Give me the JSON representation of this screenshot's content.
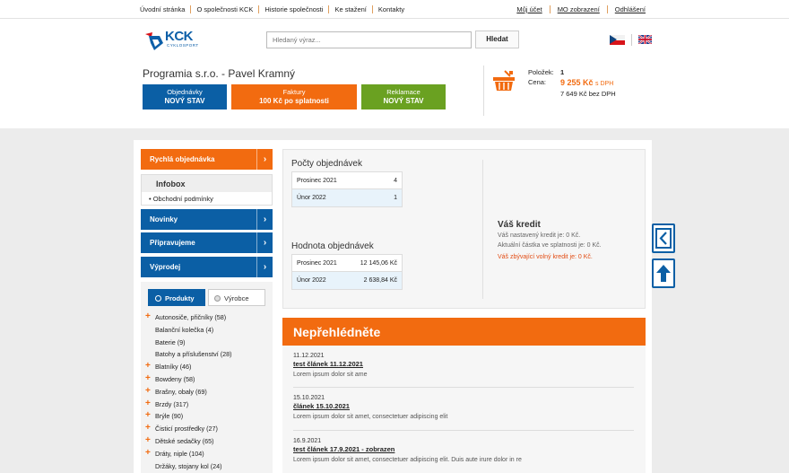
{
  "top_nav": {
    "left": [
      "Úvodní stránka",
      "O společnosti KCK",
      "Historie společnosti",
      "Ke stažení",
      "Kontakty"
    ],
    "right": [
      "Můj účet",
      "MO zobrazení",
      "Odhlášení"
    ]
  },
  "logo": {
    "text": "KCK",
    "sub": "CYKLOSPORT"
  },
  "search": {
    "placeholder": "Hledaný výraz...",
    "button": "Hledat"
  },
  "company": "Programia s.r.o. - Pavel Kramný",
  "tiles": {
    "orders": {
      "line1": "Objednávky",
      "line2": "NOVÝ STAV"
    },
    "invoices": {
      "line1": "Faktury",
      "line2": "100 Kč po splatnosti"
    },
    "complaints": {
      "line1": "Reklamace",
      "line2": "NOVÝ STAV"
    }
  },
  "cart": {
    "items_label": "Položek:",
    "items": "1",
    "price_label": "Cena:",
    "price_vat": "9 255 Kč",
    "vat_suffix": "s DPH",
    "price_novat": "7 649 Kč bez DPH"
  },
  "sidebar": {
    "quick_order": "Rychlá objednávka",
    "infobox_title": "Infobox",
    "infobox_item": "Obchodní podmínky",
    "news": "Novinky",
    "upcoming": "Připravujeme",
    "sale": "Výprodej",
    "toggle_products": "Produkty",
    "toggle_manufacturer": "Výrobce",
    "categories": [
      {
        "label": "Autonosiče, přičníky",
        "count": "(58)",
        "plus": true
      },
      {
        "label": "Balanční kolečka",
        "count": "(4)",
        "plus": false
      },
      {
        "label": "Baterie",
        "count": "(9)",
        "plus": false
      },
      {
        "label": "Batohy a příslušenství",
        "count": "(28)",
        "plus": false
      },
      {
        "label": "Blatníky",
        "count": "(46)",
        "plus": true
      },
      {
        "label": "Bowdeny",
        "count": "(58)",
        "plus": true
      },
      {
        "label": "Brašny, obaly",
        "count": "(69)",
        "plus": true
      },
      {
        "label": "Brzdy",
        "count": "(317)",
        "plus": true
      },
      {
        "label": "Brýle",
        "count": "(90)",
        "plus": true
      },
      {
        "label": "Čisticí prostředky",
        "count": "(27)",
        "plus": true
      },
      {
        "label": "Dětské sedačky",
        "count": "(65)",
        "plus": true
      },
      {
        "label": "Dráty, niple",
        "count": "(104)",
        "plus": true
      },
      {
        "label": "Držáky, stojany kol",
        "count": "(24)",
        "plus": false
      }
    ]
  },
  "stats": {
    "counts_title": "Počty objednávek",
    "counts": [
      {
        "month": "Prosinec 2021",
        "value": "4"
      },
      {
        "month": "Únor 2022",
        "value": "1"
      }
    ],
    "values_title": "Hodnota objednávek",
    "values": [
      {
        "month": "Prosinec 2021",
        "value": "12 145,06 Kč"
      },
      {
        "month": "Únor 2022",
        "value": "2 638,84 Kč"
      }
    ],
    "credit_title": "Váš kredit",
    "credit_set": "Váš nastavený kredit je: 0 Kč.",
    "credit_due": "Aktuální částka ve splatnosti je: 0 Kč.",
    "credit_free": "Váš zbývající volný kredit je: 0 Kč."
  },
  "news": {
    "title": "Nepřehlédněte",
    "items": [
      {
        "date": "11.12.2021",
        "title": "test článek 11.12.2021",
        "text": "Lorem ipsum dolor sit ame"
      },
      {
        "date": "15.10.2021",
        "title": "článek 15.10.2021",
        "text": "Lorem ipsum dolor sit amet, consectetuer adipiscing elit"
      },
      {
        "date": "16.9.2021",
        "title": "test článek 17.9.2021 - zobrazen",
        "text": "Lorem ipsum dolor sit amet, consectetuer adipiscing elit. Duis aute irure dolor in re"
      }
    ]
  },
  "colors": {
    "brand_blue": "#0b5fa5",
    "orange": "#f26b10",
    "green": "#6aa121"
  }
}
